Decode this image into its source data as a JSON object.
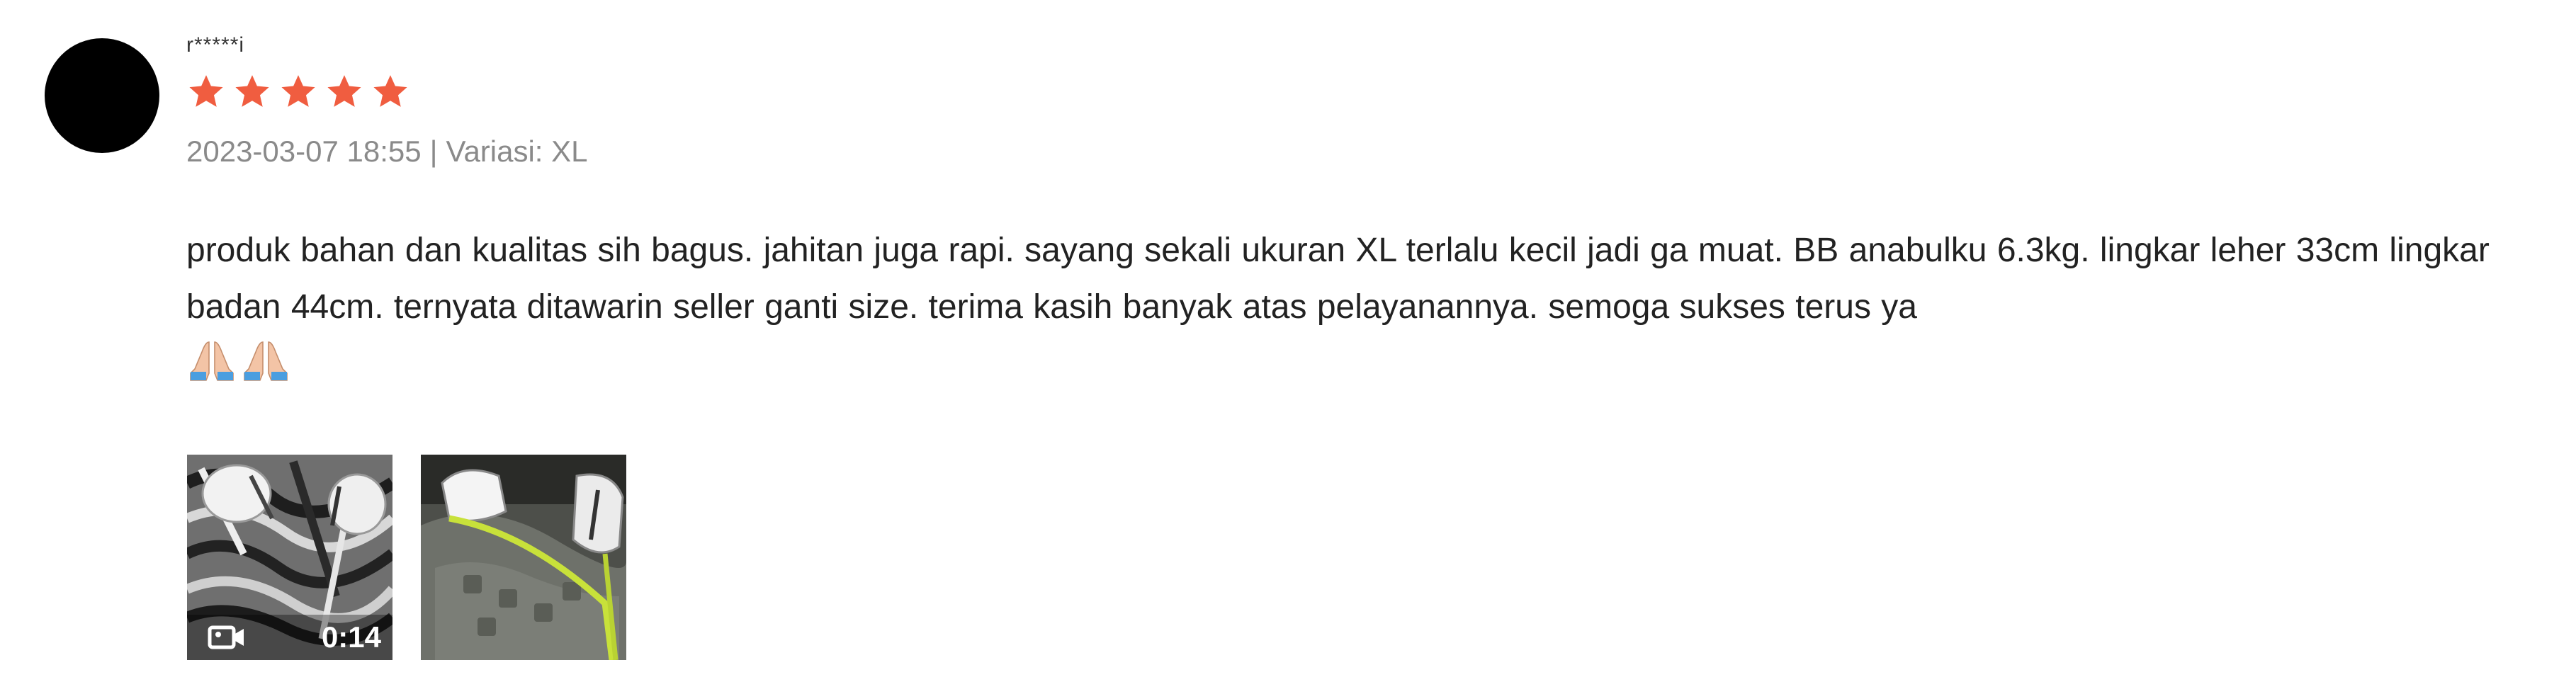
{
  "review": {
    "username": "r*****i",
    "rating": 5,
    "max_rating": 5,
    "star_color": "#f05d40",
    "date": "2023-03-07 18:55",
    "separator": "|",
    "variation": "Variasi: XL",
    "comment": "produk bahan dan kualitas sih bagus. jahitan juga rapi. sayang sekali ukuran XL terlalu kecil jadi ga muat. BB anabulku 6.3kg. lingkar leher 33cm lingkar badan 44cm. ternyata ditawarin seller ganti size. terima kasih banyak atas pelayanannya. semoga sukses terus ya",
    "emojis": [
      "folded-hands-icon",
      "folded-hands-icon"
    ]
  },
  "media": [
    {
      "type": "video",
      "icon": "video-camera-icon",
      "duration": "0:14"
    },
    {
      "type": "image"
    }
  ]
}
